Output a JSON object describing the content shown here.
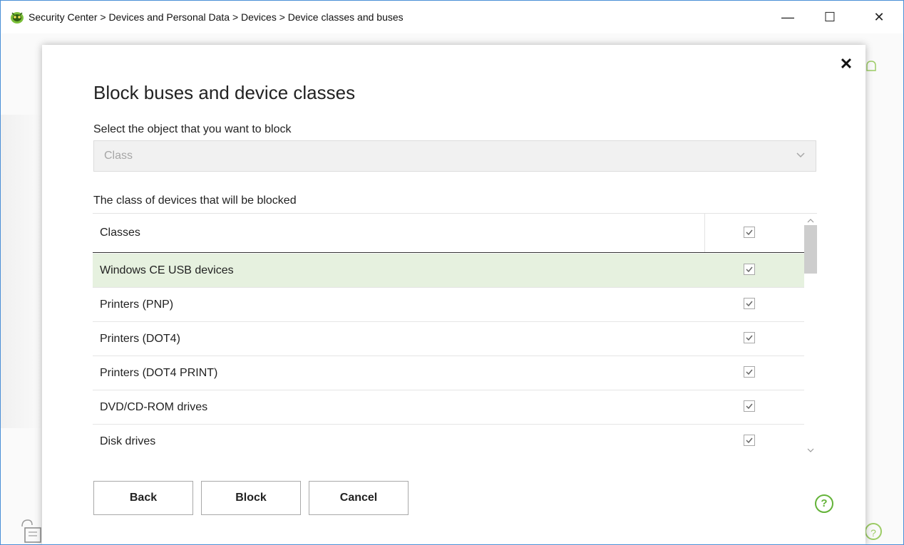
{
  "window": {
    "title": "Security Center > Devices and Personal Data > Devices > Device classes and buses",
    "controls": {
      "minimize": "—",
      "maximize": "☐",
      "close": "✕"
    }
  },
  "dialog": {
    "close_glyph": "✕",
    "title": "Block buses and device classes",
    "select_label": "Select the object that you want to block",
    "select_value": "Class",
    "table_label": "The class of devices that will be blocked",
    "table_header": "Classes",
    "rows": [
      {
        "label": "Windows CE USB devices",
        "checked": true,
        "selected": true
      },
      {
        "label": "Printers (PNP)",
        "checked": true
      },
      {
        "label": "Printers (DOT4)",
        "checked": true
      },
      {
        "label": "Printers (DOT4 PRINT)",
        "checked": true
      },
      {
        "label": "DVD/CD-ROM drives",
        "checked": true
      },
      {
        "label": "Disk drives",
        "checked": true
      }
    ],
    "buttons": {
      "back": "Back",
      "block": "Block",
      "cancel": "Cancel"
    },
    "help_glyph": "?"
  },
  "background": {
    "help_glyph": "?"
  },
  "colors": {
    "selected_row": "#e6f1df",
    "accent_green": "#63b338",
    "window_border": "#4a8fd6"
  },
  "icons": {
    "app_logo": "cat-eye-logo-icon",
    "checkbox": "checkmark-icon",
    "select": "chevron-down-icon",
    "help": "question-circle-icon"
  }
}
